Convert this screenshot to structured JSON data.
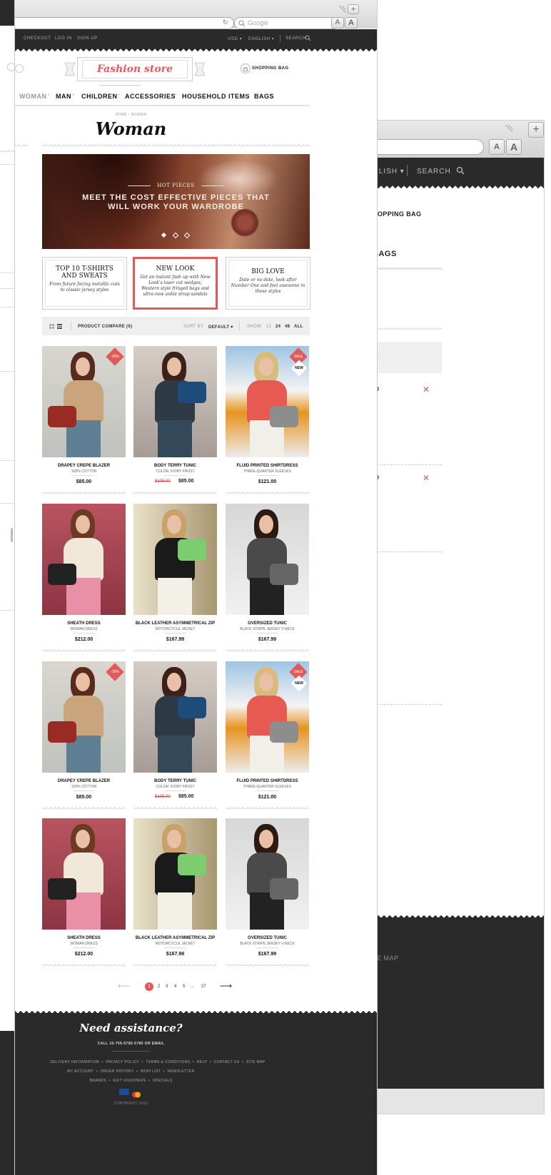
{
  "colors": {
    "accent": "#e05a5a",
    "dark": "#2a2a2a",
    "tan": "#d4b08c"
  },
  "browser": {
    "search_placeholder": "Google",
    "font_small": "A",
    "font_large": "A",
    "new_tab": "+"
  },
  "back_window": {
    "topbar_lang": "GLISH ▾",
    "topbar_search": "SEARCH",
    "shopping_bag": "HOPPING BAG",
    "nav_item": "BAGS",
    "cart_label": "AL",
    "cart_row1": "00",
    "cart_row2": "00",
    "footer_link": "TE MAP"
  },
  "topbar": {
    "checkout": "CHECKOUT",
    "login": "LOG IN",
    "signup": "SIGN UP",
    "currency": "USD ▾",
    "language": "ENGLISH ▾",
    "search": "SEARCH"
  },
  "header": {
    "logo": "Fashion store",
    "shopping_bag": "SHOPPING BAG"
  },
  "nav": {
    "items": [
      "WOMAN",
      "MAN",
      "CHILDREN",
      "ACCESSORIES",
      "HOUSEHOLD ITEMS",
      "BAGS"
    ]
  },
  "breadcrumb": {
    "home": "HOME",
    "current": "WOMAN"
  },
  "page_title": "Woman",
  "hero": {
    "kicker": "HOT PIECES",
    "line1": "MEET THE COST EFFECTIVE PIECES THAT",
    "line2": "WILL WORK YOUR WARDROBE"
  },
  "promos": [
    {
      "title": "TOP 10 T-SHIRTS AND SWEATS",
      "desc": "From future facing metallic cuts to classic jersey styles"
    },
    {
      "title": "NEW LOOK",
      "desc": "Get an instant fash up with New Look's laser cut wedges, Western style fringed bags and ultra-now ankle strap sandals"
    },
    {
      "title": "BIG LOVE",
      "desc": "Date or no date, look after Number One and feel awesome in these styles"
    }
  ],
  "toolbar": {
    "compare": "PRODUCT COMPARE (0)",
    "sort_label": "SORT BY:",
    "sort_value": "DEFAULT ▾",
    "show_label": "SHOW:",
    "show_options": [
      "12",
      "24",
      "48",
      "ALL"
    ]
  },
  "products": [
    {
      "name": "DRAPEY CREPE BLAZER",
      "sub": "100% COTTON",
      "price": "$85.00",
      "old": "",
      "badge": "-25%",
      "new": ""
    },
    {
      "name": "BODY TERRY TUNIC",
      "sub": "COLOR: IVORY FROST",
      "price": "$85.00",
      "old": "$105.00",
      "badge": "",
      "new": ""
    },
    {
      "name": "FLUID PRINTED SHIRTDRESS",
      "sub": "THREE-QUARTER SLEEVES",
      "price": "$121.00",
      "old": "",
      "badge": "SALE",
      "new": "NEW"
    },
    {
      "name": "SHEATH DRESS",
      "sub": "WOMAN DRESS",
      "price": "$212.00",
      "old": "",
      "badge": "",
      "new": ""
    },
    {
      "name": "BLACK LEATHER ASYMMETRICAL ZIP",
      "sub": "MOTORCYCLE JACKET",
      "price": "$167.99",
      "old": "",
      "badge": "",
      "new": ""
    },
    {
      "name": "OVERSIZED TUNIC",
      "sub": "BLACK STRIPE JERSEY V-NECK",
      "price": "$167.99",
      "old": "",
      "badge": "",
      "new": ""
    },
    {
      "name": "DRAPEY CREPE BLAZER",
      "sub": "100% COTTON",
      "price": "$85.00",
      "old": "",
      "badge": "-25%",
      "new": ""
    },
    {
      "name": "BODY TERRY TUNIC",
      "sub": "COLOR: IVORY FROST",
      "price": "$85.00",
      "old": "$105.00",
      "badge": "",
      "new": ""
    },
    {
      "name": "FLUID PRINTED SHIRTDRESS",
      "sub": "THREE-QUARTER SLEEVES",
      "price": "$121.00",
      "old": "",
      "badge": "SALE",
      "new": "NEW"
    },
    {
      "name": "SHEATH DRESS",
      "sub": "WOMAN DRESS",
      "price": "$212.00",
      "old": "",
      "badge": "",
      "new": ""
    },
    {
      "name": "BLACK LEATHER ASYMMETRICAL ZIP",
      "sub": "MOTORCYCLE JACKET",
      "price": "$167.99",
      "old": "",
      "badge": "",
      "new": ""
    },
    {
      "name": "OVERSIZED TUNIC",
      "sub": "BLACK STRIPE JERSEY V-NECK",
      "price": "$167.99",
      "old": "",
      "badge": "",
      "new": ""
    }
  ],
  "pager": {
    "pages": [
      "1",
      "2",
      "3",
      "4",
      "5",
      "...",
      "27"
    ],
    "current": "1"
  },
  "footer": {
    "title": "Need assistance?",
    "contact": "CALL 10-756-5780-5780 OR EMAIL",
    "row1": [
      "DELIVERY INFORMATION",
      "PRIVACY POLICY",
      "TERMS & CONDITIONS",
      "HELP",
      "CONTACT US",
      "SITE MAP"
    ],
    "row2": [
      "MY ACCOUNT",
      "ORDER HISTORY",
      "WISH LIST",
      "NEWSLETTER"
    ],
    "row3": [
      "BRANDS",
      "GIFT VOUCHERS",
      "SPECIALS"
    ],
    "copyright": "COPYRIGHT 2012"
  }
}
